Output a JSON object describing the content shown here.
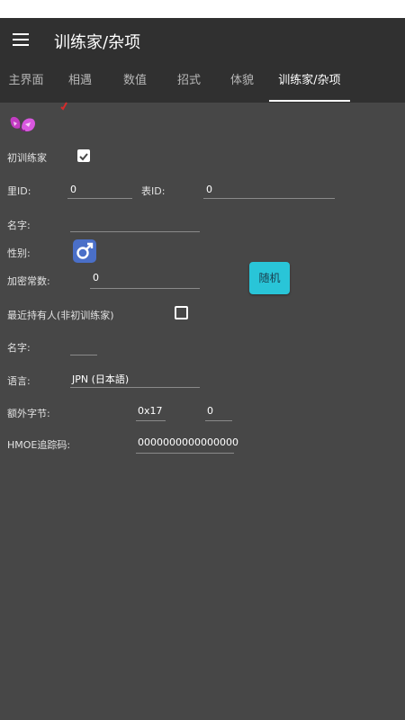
{
  "appbar": {
    "title": "训练家/杂项"
  },
  "tabs": [
    {
      "label": "主界面"
    },
    {
      "label": "相遇"
    },
    {
      "label": "数值"
    },
    {
      "label": "招式"
    },
    {
      "label": "体貌"
    },
    {
      "label": "训练家/杂项"
    }
  ],
  "form": {
    "origin_trainer_label": "初训练家",
    "origin_trainer_checked": true,
    "sid_label": "里ID:",
    "sid_value": "0",
    "tid_label": "表ID:",
    "tid_value": "0",
    "ot_name_label": "名字:",
    "ot_name_value": "",
    "gender_label": "性别:",
    "gender_value": "male",
    "encryption_label": "加密常数:",
    "encryption_value": "0",
    "random_button": "随机",
    "handler_label": "最近持有人(非初训练家)",
    "handler_checked": false,
    "handler_name_label": "名字:",
    "handler_name_value": "",
    "language_label": "语言:",
    "language_value": "JPN (日本語)",
    "extra_bytes_label": "额外字节:",
    "extra_bytes_offset": "0x17",
    "extra_bytes_value": "0",
    "tracker_label": "HMOE追踪码:",
    "tracker_value": "0000000000000000"
  },
  "icons": {
    "menu": "hamburger-menu-icon",
    "sprite": "pokemon-sprite-icon",
    "gender": "male-symbol-icon",
    "checked": "checkbox-checked-icon",
    "unchecked": "checkbox-unchecked-icon"
  },
  "colors": {
    "accent_tab_indicator": "#ffffff",
    "random_button": "#29c5d8",
    "gender_button": "#4a6fc8"
  }
}
